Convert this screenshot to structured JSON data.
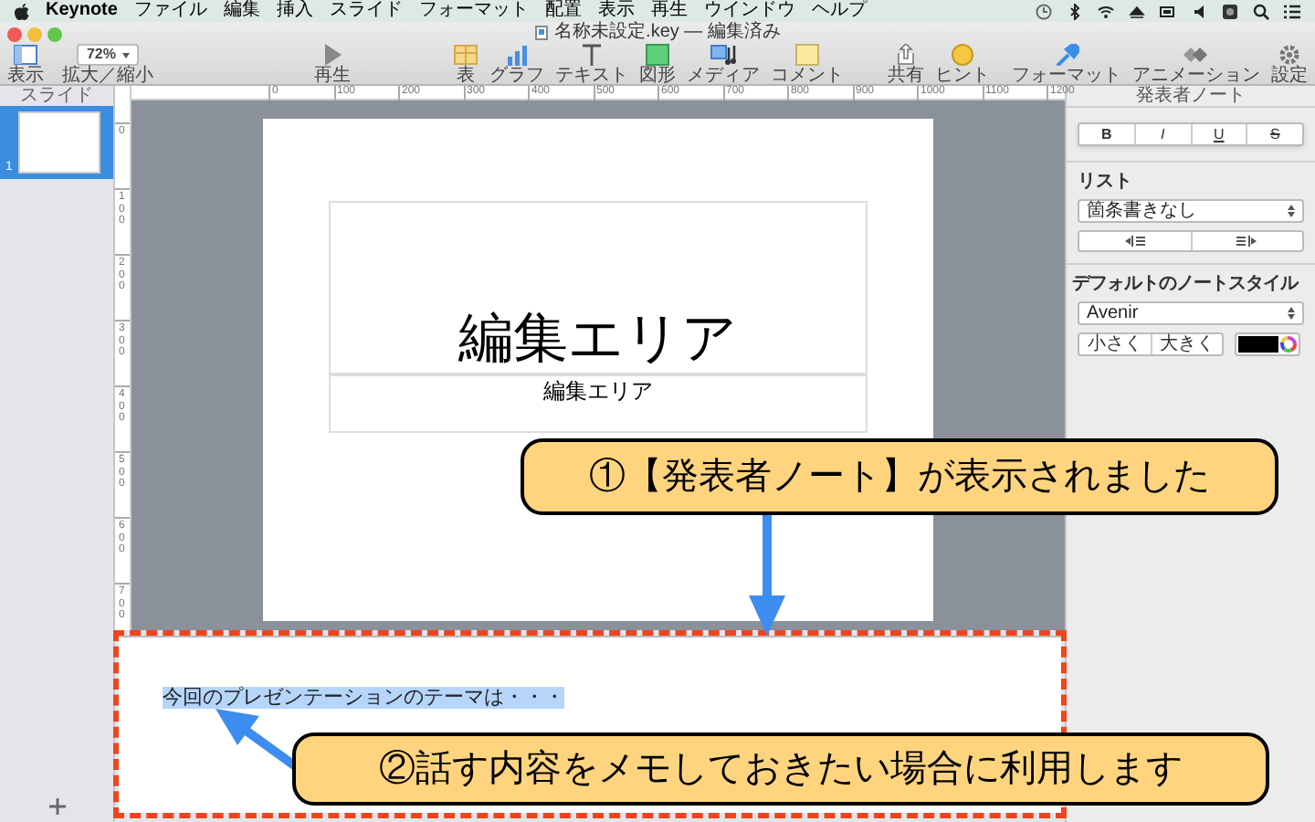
{
  "menu_bar": {
    "app": "Keynote",
    "items": [
      "ファイル",
      "編集",
      "挿入",
      "スライド",
      "フォーマット",
      "配置",
      "表示",
      "再生",
      "ウインドウ",
      "ヘルプ"
    ]
  },
  "window": {
    "title": "名称未設定.key",
    "subtitle": "— 編集済み"
  },
  "toolbar": {
    "zoom": "72%",
    "left": [
      "表示",
      "拡大／縮小"
    ],
    "play": "再生",
    "insert": [
      "表",
      "グラフ",
      "テキスト",
      "図形",
      "メディア",
      "コメント"
    ],
    "share": [
      "共有",
      "ヒント"
    ],
    "right": [
      "フォーマット",
      "アニメーション",
      "設定"
    ]
  },
  "sidebar": {
    "header": "スライド",
    "slides": [
      {
        "number": "1",
        "selected": true
      }
    ]
  },
  "ruler": {
    "horizontal": [
      "0",
      "100",
      "200",
      "300",
      "400",
      "500",
      "600",
      "700",
      "800",
      "900",
      "1000",
      "1100",
      "1200"
    ],
    "vertical": [
      "0",
      "100",
      "200",
      "300",
      "400",
      "500",
      "600",
      "700"
    ]
  },
  "slide": {
    "title": "編集エリア",
    "subtitle": "編集エリア"
  },
  "notes": {
    "text": "今回のプレゼンテーションのテーマは・・・",
    "text_selected": true
  },
  "inspector": {
    "header": "発表者ノート",
    "style_buttons": [
      "B",
      "I",
      "U",
      "S"
    ],
    "list_label": "リスト",
    "list_style": "箇条書きなし",
    "default_style_label": "デフォルトのノートスタイル",
    "font": "Avenir",
    "size_buttons": [
      "小さく",
      "大きく"
    ]
  },
  "callouts": [
    {
      "text": "①【発表者ノート】が表示されました"
    },
    {
      "text": "②話す内容をメモしておきたい場合に利用します"
    }
  ]
}
